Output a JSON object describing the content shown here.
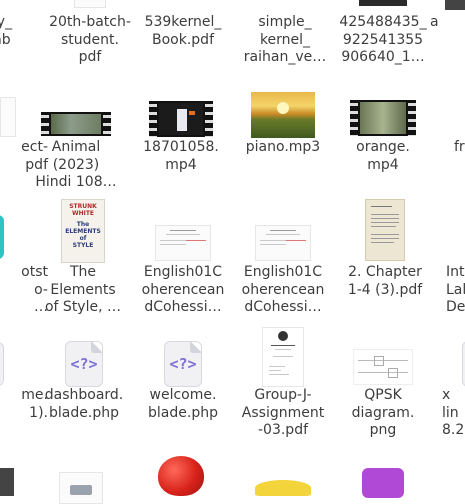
{
  "files": [
    {
      "label": "py_\nlab",
      "type": "partial-doc"
    },
    {
      "label": "20th-batch-\nstudent.\npdf",
      "type": "pdf"
    },
    {
      "label": "539kernel_\nBook.pdf",
      "type": "pdf"
    },
    {
      "label": "simple_\nkernel_\nraihan_ve…",
      "type": "doc"
    },
    {
      "label": "425488435_\n922541355\n906640_1…",
      "type": "image"
    },
    {
      "label": "a",
      "type": "partial"
    },
    {
      "label": "ect-\npdf",
      "type": "pdf"
    },
    {
      "label": "Animal\n(2023)\nHindi 108…",
      "type": "video"
    },
    {
      "label": "18701058.\nmp4",
      "type": "video"
    },
    {
      "label": "piano.mp3",
      "type": "audio-art"
    },
    {
      "label": "orange.\nmp4",
      "type": "video"
    },
    {
      "label": "fr",
      "type": "partial"
    },
    {
      "label": "otst\no-\n…",
      "type": "app"
    },
    {
      "label": "The\nElements\nof Style, …",
      "type": "pdf"
    },
    {
      "label": "English01C\noherencean\ndCohessi…",
      "type": "pdf"
    },
    {
      "label": "English01C\noherencean\ndCohessi…",
      "type": "pdf"
    },
    {
      "label": "2. Chapter\n1-4 (3).pdf",
      "type": "pdf"
    },
    {
      "label": "Int\nLal\nDe",
      "type": "partial"
    },
    {
      "label": "me.\n1).",
      "type": "partial"
    },
    {
      "label": "dashboard.\nblade.php",
      "type": "php"
    },
    {
      "label": "welcome.\nblade.php",
      "type": "php"
    },
    {
      "label": "Group-J-\nAssignment\n-03.pdf",
      "type": "pdf"
    },
    {
      "label": "QPSK\ndiagram.\npng",
      "type": "image"
    },
    {
      "label": "x\nlin\n8.2",
      "type": "partial"
    }
  ],
  "thumbnail_text": {
    "book_title": "The\nELEMENTS\nof\nSTYLE",
    "book_strunk": "STRUNK\nWHITE",
    "php_glyph": "<?>"
  },
  "colors": {
    "background": "#ffffff",
    "label": "#3d3d3d",
    "php_glyph": "#7d6fd6",
    "teal_app": "#2ec4c4",
    "apple_red": "#d8231b",
    "purple_app": "#b04ad6"
  }
}
